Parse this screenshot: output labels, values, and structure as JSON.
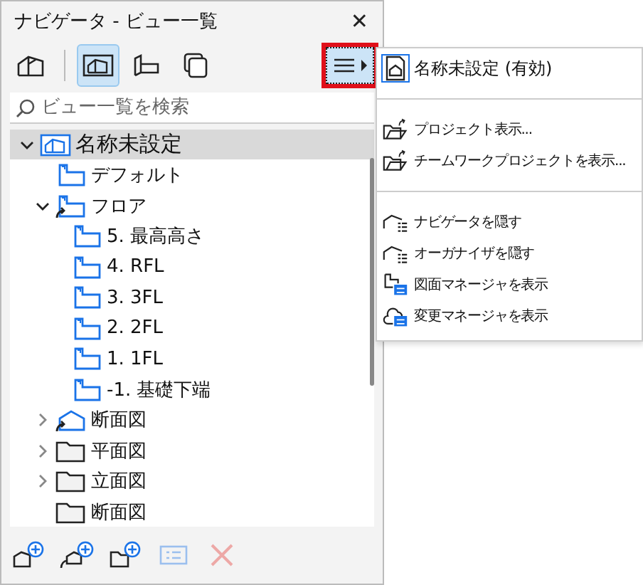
{
  "window": {
    "title": "ナビゲータ - ビュー一覧",
    "close": "✕"
  },
  "view_modes": [
    {
      "kind": "project",
      "selected": false
    },
    {
      "kind": "view-map",
      "selected": true
    },
    {
      "kind": "layout",
      "selected": false
    },
    {
      "kind": "publisher",
      "selected": false
    }
  ],
  "menu_button": {
    "highlighted": true
  },
  "search": {
    "placeholder": "ビュー一覧を検索"
  },
  "tree": [
    {
      "label": "名称未設定",
      "kind": "root",
      "selected": true,
      "expanded": true,
      "children": [
        {
          "label": "デフォルト",
          "kind": "view",
          "selected": false
        },
        {
          "label": "フロア",
          "kind": "view-link",
          "selected": false,
          "expanded": true,
          "children": [
            {
              "label": "5. 最高高さ",
              "kind": "view",
              "selected": false
            },
            {
              "label": "4. RFL",
              "kind": "view",
              "selected": false
            },
            {
              "label": "3. 3FL",
              "kind": "view",
              "selected": false
            },
            {
              "label": "2. 2FL",
              "kind": "view",
              "selected": false
            },
            {
              "label": "1. 1FL",
              "kind": "view",
              "selected": false
            },
            {
              "label": "-1. 基礎下端",
              "kind": "view",
              "selected": false
            }
          ]
        },
        {
          "label": "断面図",
          "kind": "section-link",
          "selected": false,
          "expanded": false
        },
        {
          "label": "平面図",
          "kind": "folder",
          "selected": false,
          "expanded": false
        },
        {
          "label": "立面図",
          "kind": "folder",
          "selected": false,
          "expanded": false
        },
        {
          "label": "断面図",
          "kind": "folder",
          "selected": false
        }
      ]
    }
  ],
  "bottom_toolbar": [
    {
      "kind": "new-view",
      "disabled": false
    },
    {
      "kind": "new-link",
      "disabled": false
    },
    {
      "kind": "new-folder",
      "disabled": false
    },
    {
      "kind": "settings",
      "disabled": true
    },
    {
      "kind": "delete",
      "disabled": true
    }
  ],
  "menu": [
    {
      "kind": "item",
      "label": "名称未設定 (有効)",
      "checked": true
    },
    {
      "kind": "separator"
    },
    {
      "kind": "item",
      "label": "プロジェクト表示..."
    },
    {
      "kind": "item",
      "label": "チームワークプロジェクトを表示..."
    },
    {
      "kind": "separator"
    },
    {
      "kind": "item",
      "label": "ナビゲータを隠す"
    },
    {
      "kind": "item",
      "label": "オーガナイザを隠す"
    },
    {
      "kind": "item",
      "label": "図面マネージャを表示"
    },
    {
      "kind": "item",
      "label": "変更マネージャを表示"
    }
  ]
}
